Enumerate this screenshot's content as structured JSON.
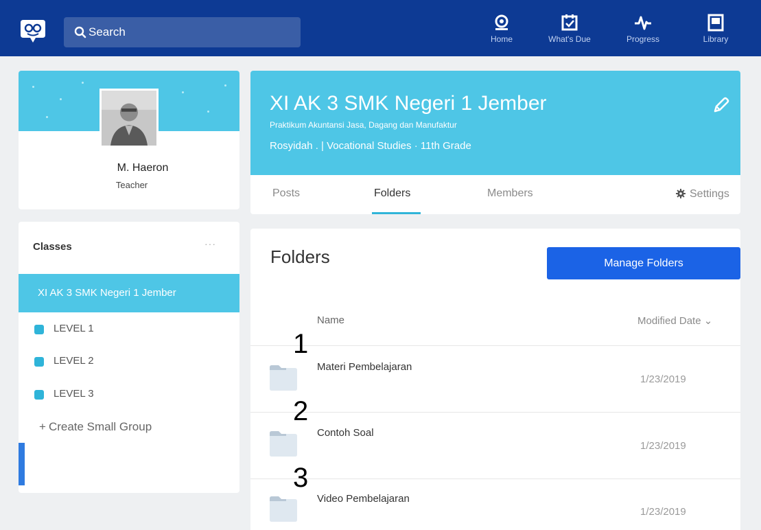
{
  "topbar": {
    "search_placeholder": "Search",
    "nav": [
      {
        "label": "Home",
        "icon": "home-icon"
      },
      {
        "label": "What's Due",
        "icon": "calendar-check-icon"
      },
      {
        "label": "Progress",
        "icon": "pulse-icon"
      },
      {
        "label": "Library",
        "icon": "library-icon"
      }
    ]
  },
  "profile": {
    "name": "M. Haeron",
    "role": "Teacher"
  },
  "sidebar": {
    "title": "Classes",
    "more": "···",
    "active_class": "XI AK 3 SMK Negeri 1 Jember",
    "groups": [
      "LEVEL 1",
      "LEVEL 2",
      "LEVEL 3"
    ],
    "create_group": "Create Small Group"
  },
  "class": {
    "title": "XI AK 3 SMK Negeri 1 Jember",
    "subtitle": "Praktikum Akuntansi Jasa, Dagang dan Manufaktur",
    "meta": "Rosyidah . | Vocational Studies · 11th Grade",
    "tabs": [
      "Posts",
      "Folders",
      "Members"
    ],
    "active_tab": "Folders",
    "settings_label": "Settings"
  },
  "folders": {
    "title": "Folders",
    "manage_button": "Manage Folders",
    "col_name": "Name",
    "col_date": "Modified Date ⌄",
    "rows": [
      {
        "number": "1",
        "name": "Materi Pembelajaran",
        "date": "1/23/2019"
      },
      {
        "number": "2",
        "name": "Contoh Soal",
        "date": "1/23/2019"
      },
      {
        "number": "3",
        "name": "Video Pembelajaran",
        "date": "1/23/2019"
      }
    ]
  },
  "colors": {
    "topbar": "#0d3a94",
    "banner": "#4ec6e6",
    "primary_button": "#1b63e6",
    "accent": "#2fb4d9"
  }
}
